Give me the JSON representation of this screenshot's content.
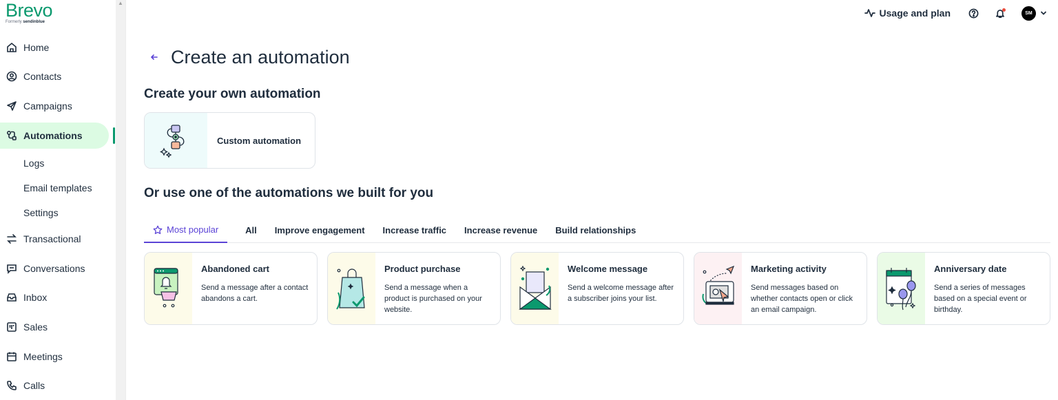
{
  "brand": {
    "name": "Brevo",
    "formerly_prefix": "Formerly",
    "formerly_name": "sendinblue",
    "color": "#0b996e"
  },
  "sidebar": {
    "items": [
      {
        "label": "Home",
        "icon": "home-icon"
      },
      {
        "label": "Contacts",
        "icon": "contacts-icon"
      },
      {
        "label": "Campaigns",
        "icon": "send-icon"
      },
      {
        "label": "Automations",
        "icon": "automation-icon",
        "active": true
      },
      {
        "label": "Transactional",
        "icon": "transfer-icon"
      },
      {
        "label": "Conversations",
        "icon": "chat-icon"
      },
      {
        "label": "Inbox",
        "icon": "inbox-icon"
      },
      {
        "label": "Sales",
        "icon": "kanban-icon"
      },
      {
        "label": "Meetings",
        "icon": "calendar-icon"
      },
      {
        "label": "Calls",
        "icon": "phone-icon"
      }
    ],
    "sub_items": [
      "Logs",
      "Email templates",
      "Settings"
    ]
  },
  "topbar": {
    "usage_label": "Usage and plan",
    "avatar_initials": "SM"
  },
  "page": {
    "title": "Create an automation",
    "own_heading": "Create your own automation",
    "custom_label": "Custom automation",
    "built_heading": "Or use one of the automations we built for you"
  },
  "tabs": [
    {
      "label": "Most popular",
      "active": true
    },
    {
      "label": "All"
    },
    {
      "label": "Improve engagement"
    },
    {
      "label": "Increase traffic"
    },
    {
      "label": "Increase revenue"
    },
    {
      "label": "Build relationships"
    }
  ],
  "cards": [
    {
      "title": "Abandoned cart",
      "desc": "Send a message after a contact abandons a cart.",
      "bg": "#fdfbe9"
    },
    {
      "title": "Product purchase",
      "desc": "Send a message when a product is purchased on your website.",
      "bg": "#fdfbe9"
    },
    {
      "title": "Welcome message",
      "desc": "Send a welcome message after a subscriber joins your list.",
      "bg": "#fdfbe9"
    },
    {
      "title": "Marketing activity",
      "desc": "Send messages based on whether contacts open or click an email campaign.",
      "bg": "#fdf1f3"
    },
    {
      "title": "Anniversary date",
      "desc": "Send a series of messages based on a special event or birthday.",
      "bg": "#eafbe6"
    }
  ],
  "colors": {
    "accent": "#5b43d6",
    "active_nav_bg": "#dcfbe3",
    "text": "#1f2d3d"
  }
}
